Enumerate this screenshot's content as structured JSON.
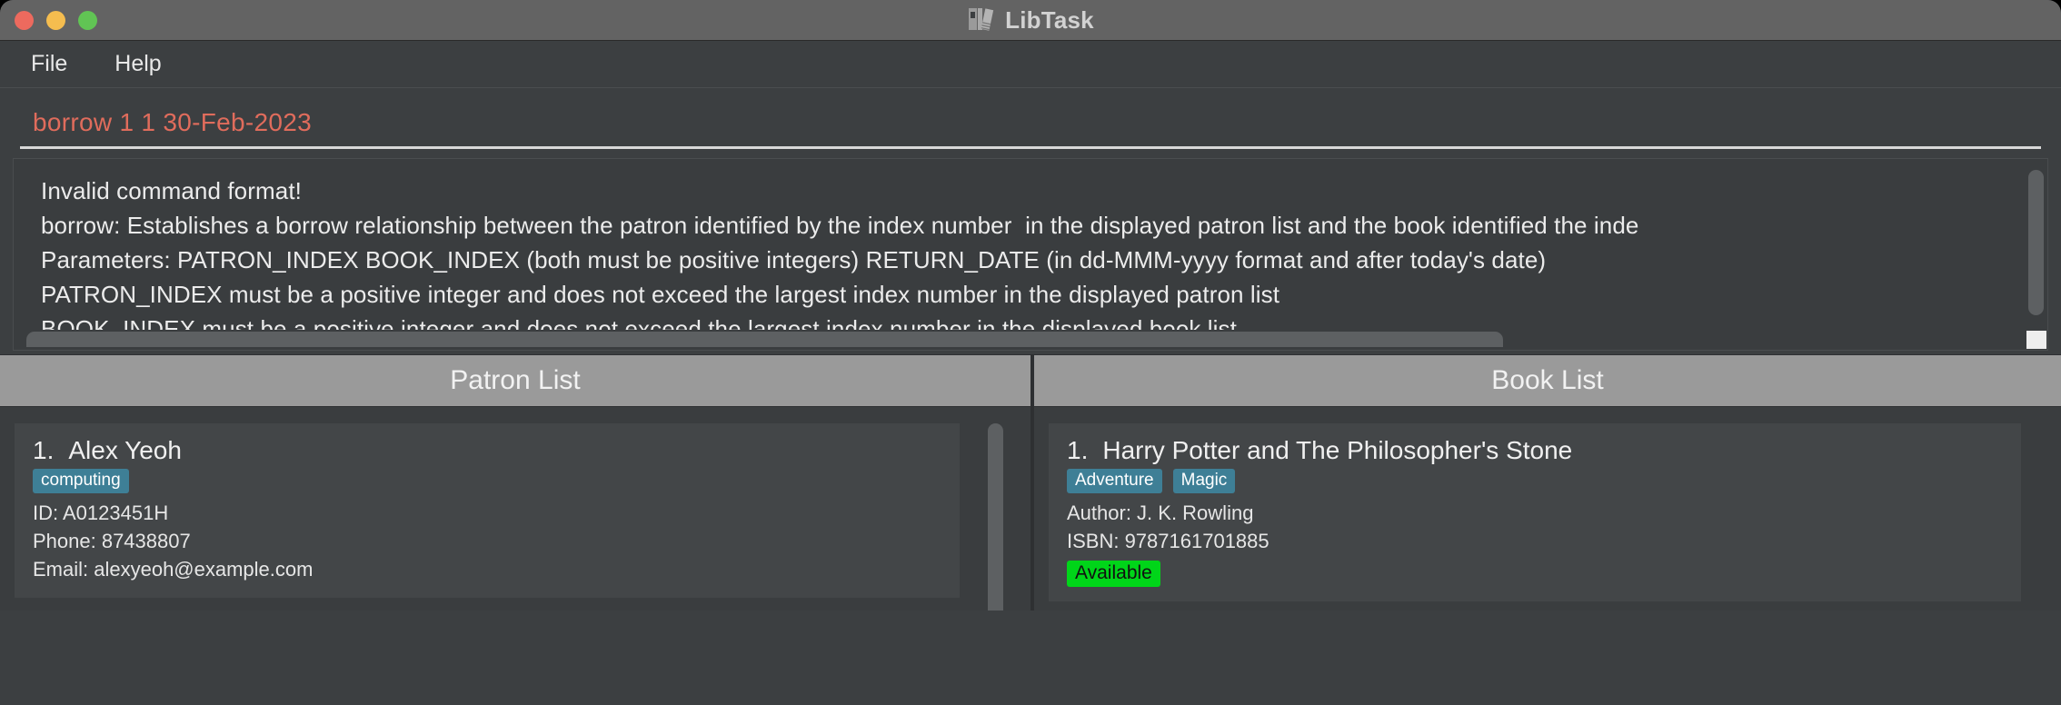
{
  "window": {
    "title": "LibTask",
    "icon": "books-icon",
    "traffic_lights": [
      {
        "name": "close",
        "color": "#ed6a5e"
      },
      {
        "name": "minimize",
        "color": "#f5bd4f"
      },
      {
        "name": "maximize",
        "color": "#61c454"
      }
    ]
  },
  "menubar": {
    "items": [
      {
        "label": "File"
      },
      {
        "label": "Help"
      }
    ]
  },
  "command": {
    "value": "borrow 1 1 30-Feb-2023",
    "color": "#e06c5c"
  },
  "result": {
    "lines": [
      "Invalid command format!",
      "borrow: Establishes a borrow relationship between the patron identified by the index number  in the displayed patron list and the book identified the inde",
      "Parameters: PATRON_INDEX BOOK_INDEX (both must be positive integers) RETURN_DATE (in dd-MMM-yyyy format and after today's date)",
      "PATRON_INDEX must be a positive integer and does not exceed the largest index number in the displayed patron list",
      "BOOK_INDEX must be a positive integer and does not exceed the largest index number in the displayed book list"
    ]
  },
  "patron_panel": {
    "header": "Patron List",
    "items": [
      {
        "index": "1.",
        "name": "Alex Yeoh",
        "tags": [
          "computing"
        ],
        "id_label": "ID: A0123451H",
        "phone_label": "Phone: 87438807",
        "email_label": "Email: alexyeoh@example.com"
      }
    ]
  },
  "book_panel": {
    "header": "Book List",
    "items": [
      {
        "index": "1.",
        "title": "Harry Potter and The Philosopher's Stone",
        "tags": [
          "Adventure",
          "Magic"
        ],
        "author_label": "Author: J. K. Rowling",
        "isbn_label": "ISBN: 9787161701885",
        "status": "Available",
        "status_color": "#00d519"
      }
    ]
  }
}
